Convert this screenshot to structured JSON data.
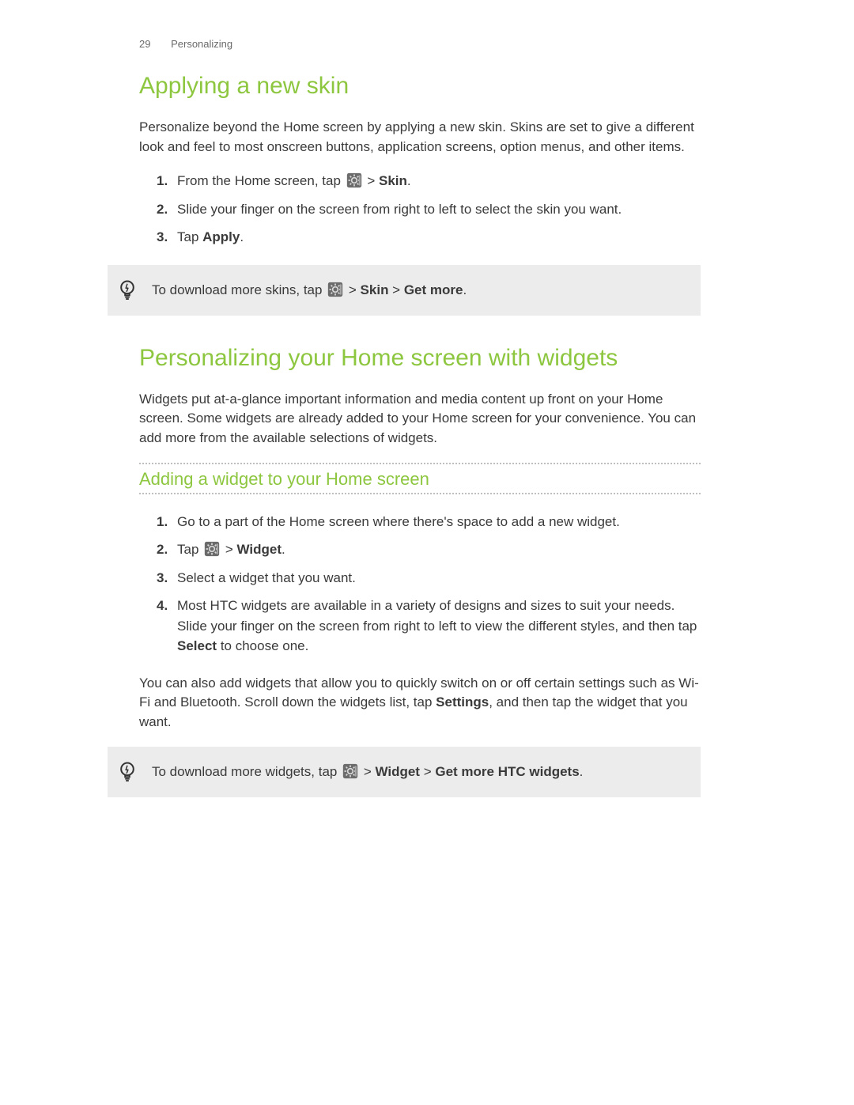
{
  "header": {
    "page_number": "29",
    "section": "Personalizing"
  },
  "section1": {
    "title": "Applying a new skin",
    "intro": "Personalize beyond the Home screen by applying a new skin. Skins are set to give a different look and feel to most onscreen buttons, application screens, option menus, and other items.",
    "steps": {
      "s1_num": "1.",
      "s1_a": "From the Home screen, tap ",
      "s1_gt": " > ",
      "s1_bold": "Skin",
      "s1_end": ".",
      "s2_num": "2.",
      "s2": "Slide your finger on the screen from right to left to select the skin you want.",
      "s3_num": "3.",
      "s3_a": "Tap ",
      "s3_bold": "Apply",
      "s3_end": "."
    },
    "tip": {
      "a": "To download more skins, tap ",
      "gt1": " > ",
      "bold1": "Skin",
      "gt2": " > ",
      "bold2": "Get more",
      "end": "."
    }
  },
  "section2": {
    "title": "Personalizing your Home screen with widgets",
    "intro": "Widgets put at-a-glance important information and media content up front on your Home screen. Some widgets are already added to your Home screen for your convenience. You can add more from the available selections of widgets.",
    "subheading": "Adding a widget to your Home screen",
    "steps": {
      "s1_num": "1.",
      "s1": "Go to a part of the Home screen where there's space to add a new widget.",
      "s2_num": "2.",
      "s2_a": "Tap ",
      "s2_gt": " > ",
      "s2_bold": "Widget",
      "s2_end": ".",
      "s3_num": "3.",
      "s3": "Select a widget that you want.",
      "s4_num": "4.",
      "s4_a": "Most HTC widgets are available in a variety of designs and sizes to suit your needs. Slide your finger on the screen from right to left to view the different styles, and then tap ",
      "s4_bold": "Select",
      "s4_end": " to choose one."
    },
    "after_a": "You can also add widgets that allow you to quickly switch on or off certain settings such as Wi-Fi and Bluetooth. Scroll down the widgets list, tap ",
    "after_bold": "Settings",
    "after_end": ", and then tap the widget that you want.",
    "tip": {
      "a": "To download more widgets, tap ",
      "gt1": " > ",
      "bold1": "Widget",
      "gt2": " > ",
      "bold2": "Get more HTC widgets",
      "end": "."
    }
  }
}
